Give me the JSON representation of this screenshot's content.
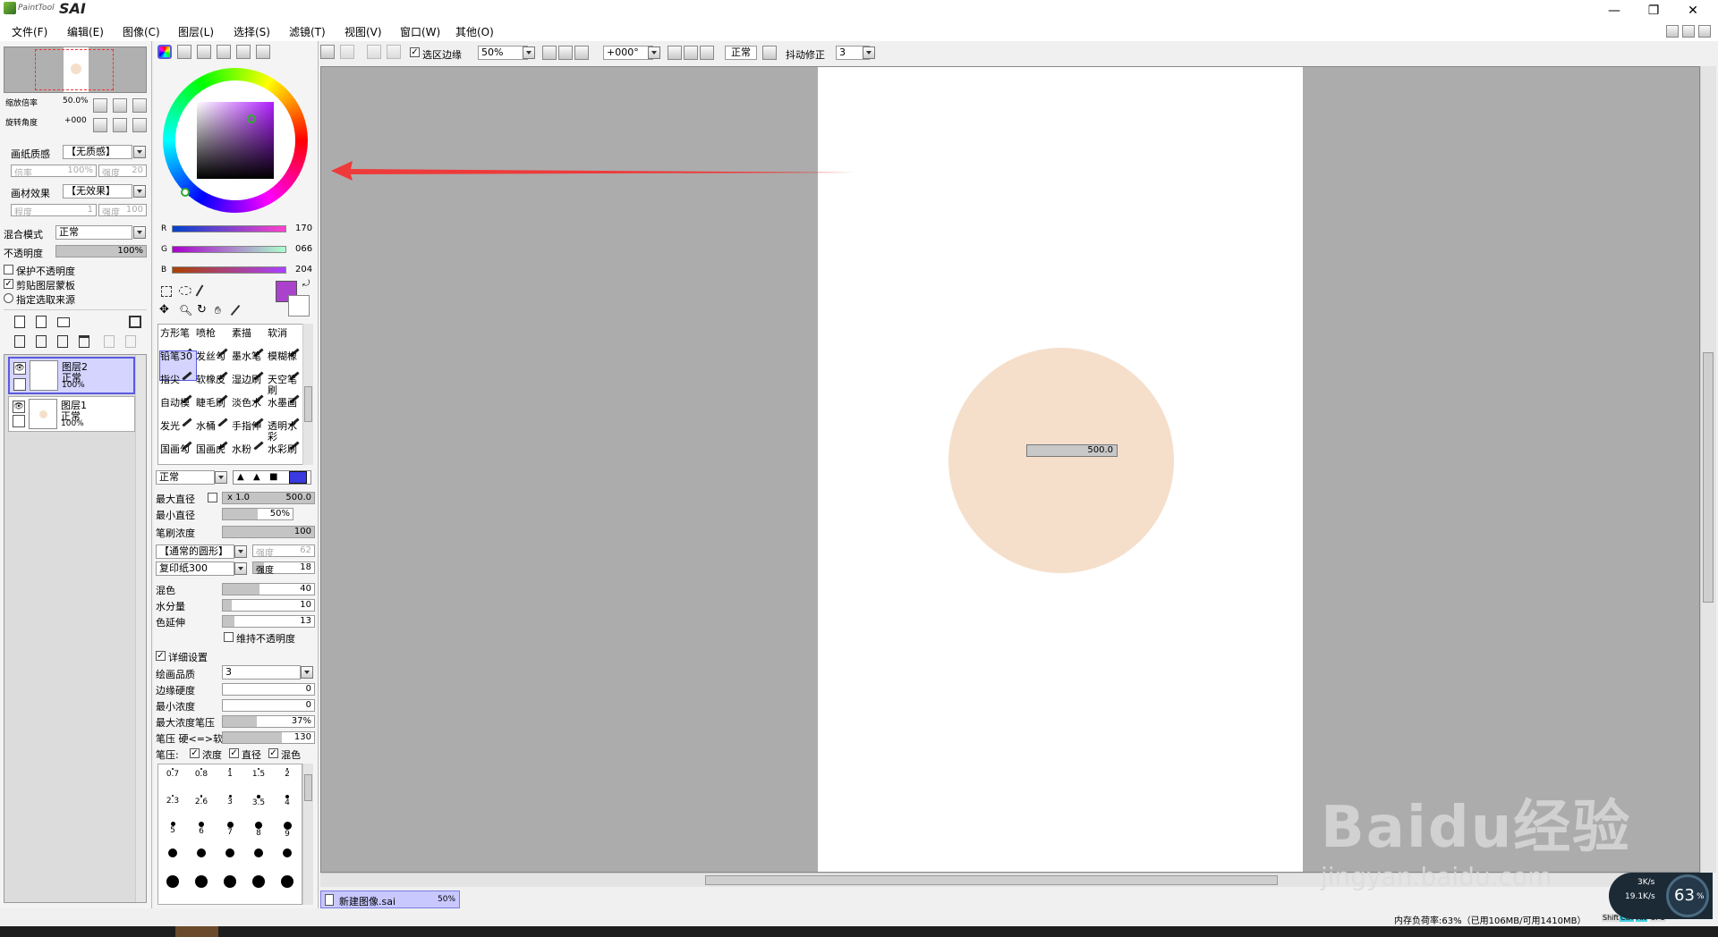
{
  "app": {
    "logo_small": "PaintTool",
    "logo_big": "SAI"
  },
  "menu": [
    "文件(F)",
    "编辑(E)",
    "图像(C)",
    "图层(L)",
    "选择(S)",
    "滤镜(T)",
    "视图(V)",
    "窗口(W)",
    "其他(O)"
  ],
  "window_controls": {
    "minimize": "—",
    "restore": "❐",
    "close": "✕"
  },
  "navigator": {
    "zoom_label": "缩放倍率",
    "zoom_value": "50.0%",
    "rotate_label": "旋转角度",
    "rotate_value": "+000"
  },
  "layer_props": {
    "paper_label": "画纸质感",
    "paper_value": "【无质感】",
    "scale_label": "倍率",
    "scale_value": "100%",
    "strength_label": "强度",
    "strength_value": "20",
    "effect_label": "画材效果",
    "effect_value": "【无效果】",
    "degree_label": "程度",
    "degree_value": "1",
    "width_label": "强度",
    "width_value": "100",
    "blend_label": "混合模式",
    "blend_value": "正常",
    "opacity_label": "不透明度",
    "opacity_value": "100%",
    "preserve_opacity": "保护不透明度",
    "clip_group": "剪贴图层蒙板",
    "selection_source": "指定选取来源"
  },
  "layers": [
    {
      "name": "图层2",
      "mode": "正常",
      "opacity": "100%",
      "selected": true
    },
    {
      "name": "图层1",
      "mode": "正常",
      "opacity": "100%",
      "selected": false
    }
  ],
  "color": {
    "r_label": "R",
    "r_value": "170",
    "g_label": "G",
    "g_value": "066",
    "b_label": "B",
    "b_value": "204",
    "primary": "#aa42cc"
  },
  "brushes": [
    "方形笔",
    "喷枪",
    "素描",
    "软消",
    "铅笔30",
    "发丝勾",
    "墨水笔",
    "模糊橡",
    "指尖",
    "软橡皮",
    "湿边刷",
    "天空笔刷",
    "自动模",
    "睫毛刷",
    "淡色水",
    "水墨画",
    "发光",
    "水桶",
    "手指伸",
    "透明水彩",
    "国画勾",
    "国画虎",
    "水粉",
    "水彩刷"
  ],
  "brush_settings": {
    "mode": "正常",
    "max_size_label": "最大直径",
    "max_size_mult": "x 1.0",
    "max_size_value": "500.0",
    "min_size_label": "最小直径",
    "min_size_value": "50%",
    "density_label": "笔刷浓度",
    "density_value": "100",
    "shape_value": "【通常的圆形】",
    "shape_strength_label": "强度",
    "shape_strength_value": "62",
    "texture_value": "复印纸300",
    "texture_strength_label": "强度",
    "texture_strength_value": "18",
    "blend_label": "混色",
    "blend_value": "40",
    "dilution_label": "水分量",
    "dilution_value": "10",
    "persistence_label": "色延伸",
    "persistence_value": "13",
    "keep_opacity": "维持不透明度",
    "advanced": "详细设置",
    "quality_label": "绘画品质",
    "quality_value": "3",
    "edge_label": "边缘硬度",
    "edge_value": "0",
    "min_density_label": "最小浓度",
    "min_density_value": "0",
    "max_pressure_label": "最大浓度笔压",
    "max_pressure_value": "37%",
    "hardness_label": "笔压 硬<=>软",
    "hardness_value": "130",
    "pressure_label": "笔压:",
    "pressure_density": "浓度",
    "pressure_size": "直径",
    "pressure_blend": "混色"
  },
  "dot_sizes": [
    "0.7",
    "0.8",
    "1",
    "1.5",
    "2",
    "2.3",
    "2.6",
    "3",
    "3.5",
    "4",
    "5",
    "6",
    "7",
    "8",
    "9"
  ],
  "toolbar": {
    "select_edge": "选区边缘",
    "zoom": "50%",
    "angle": "+000°",
    "mode": "正常",
    "stabilizer_label": "抖动修正",
    "stabilizer_value": "3"
  },
  "canvas": {
    "size_tip": "500.0",
    "circle_color": "#f5dfcb"
  },
  "doc_tab": {
    "name": "新建图像.sai",
    "zoom": "50%"
  },
  "status": {
    "memory": "内存负荷率:63%（已用106MB/可用1410MB）",
    "keys": [
      "Shift",
      "Ctrl",
      "Alt",
      "SPC"
    ]
  },
  "net_widget": {
    "up": "3K/s",
    "down": "19.1K/s",
    "percent": "63",
    "unit": "%"
  },
  "watermark": {
    "brand": "Baidu经验",
    "url": "jingyan.baidu.com"
  }
}
